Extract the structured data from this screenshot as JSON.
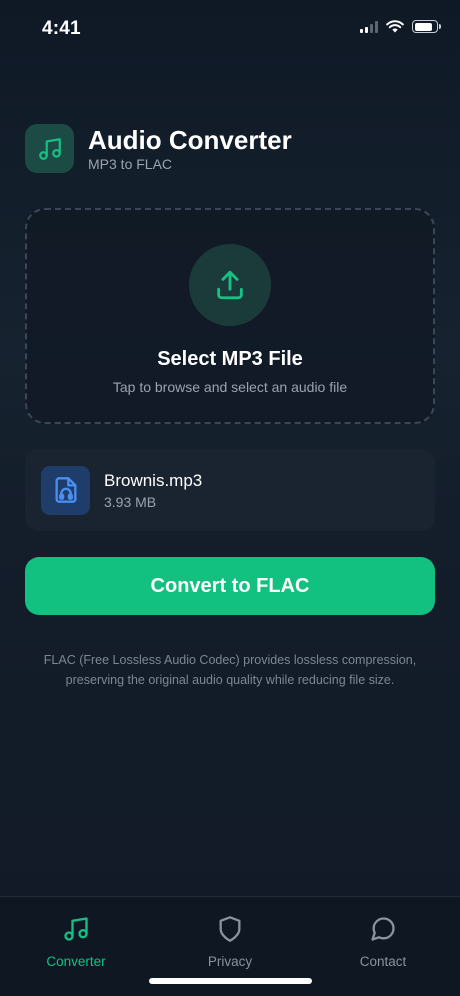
{
  "status_bar": {
    "time": "4:41",
    "signal_bars": 2,
    "signal_total": 4,
    "battery_level": 0.85
  },
  "header": {
    "title": "Audio Converter",
    "subtitle": "MP3 to FLAC",
    "logo_icon": "music-note-icon"
  },
  "dropzone": {
    "title": "Select MP3 File",
    "hint": "Tap to browse and select an audio file",
    "icon": "upload-icon"
  },
  "file": {
    "name": "Brownis.mp3",
    "size": "3.93 MB",
    "icon": "audio-file-icon"
  },
  "convert_button": {
    "label": "Convert to FLAC"
  },
  "info": {
    "text": "FLAC (Free Lossless Audio Codec) provides lossless compression, preserving the original audio quality while reducing file size."
  },
  "tabs": [
    {
      "label": "Converter",
      "icon": "music-note-icon",
      "active": true
    },
    {
      "label": "Privacy",
      "icon": "shield-icon",
      "active": false
    },
    {
      "label": "Contact",
      "icon": "chat-bubble-icon",
      "active": false
    }
  ],
  "colors": {
    "accent": "#12c080",
    "background": "#131c29",
    "file_icon_bg": "#1f3d6a",
    "muted_text": "#9aa3b0"
  }
}
